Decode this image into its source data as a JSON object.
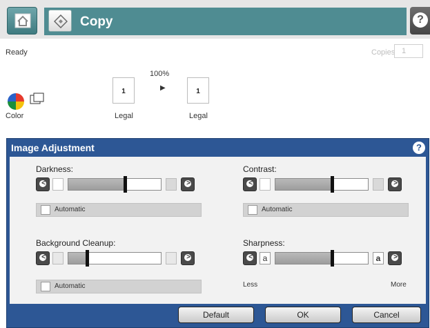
{
  "header": {
    "title": "Copy",
    "home_icon": "home-icon",
    "copy_icon": "copy-icon",
    "help_label": "?",
    "strip_color": "#4f8c92"
  },
  "status": {
    "text": "Ready",
    "copies_label": "Copies:",
    "copies_value": "1"
  },
  "preview": {
    "zoom": "100%",
    "input_pages": "1",
    "output_pages": "1",
    "input_paper": "Legal",
    "output_paper": "Legal",
    "color_label": "Color"
  },
  "dialog": {
    "title": "Image Adjustment",
    "help_label": "?",
    "accent": "#2d5795",
    "darkness": {
      "label": "Darkness:",
      "level": 0.61,
      "auto_label": "Automatic",
      "auto_checked": false
    },
    "contrast": {
      "label": "Contrast:",
      "level": 0.61,
      "auto_label": "Automatic",
      "auto_checked": false
    },
    "background": {
      "label": "Background Cleanup:",
      "level": 0.2,
      "auto_label": "Automatic",
      "auto_checked": false
    },
    "sharpness": {
      "label": "Sharpness:",
      "level": 0.61,
      "less_label": "Less",
      "more_label": "More",
      "letter": "a"
    },
    "buttons": {
      "default": "Default",
      "ok": "OK",
      "cancel": "Cancel"
    }
  }
}
